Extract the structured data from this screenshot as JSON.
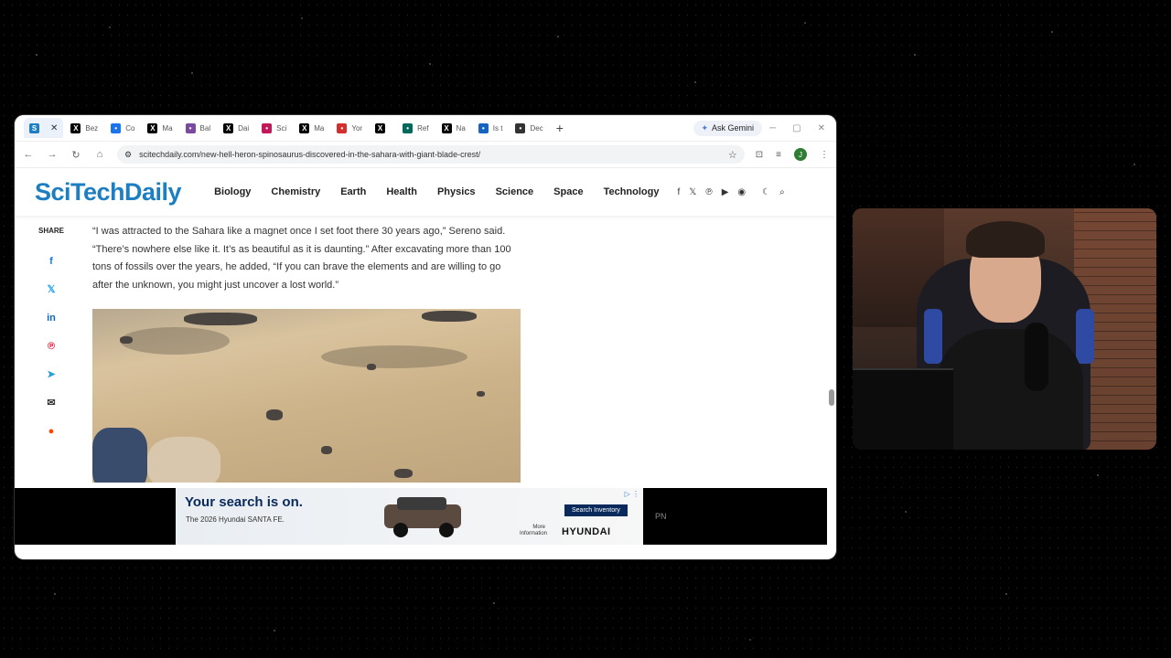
{
  "browser": {
    "tabs": [
      {
        "label": "",
        "icon": "scitechdaily-icon",
        "color": "#1d7fc1",
        "active": true
      },
      {
        "label": "Bez",
        "icon": "x-icon",
        "color": "#000000"
      },
      {
        "label": "Co",
        "icon": "generic-icon",
        "color": "#1a73e8"
      },
      {
        "label": "Ma",
        "icon": "x-icon",
        "color": "#000000"
      },
      {
        "label": "Bal",
        "icon": "generic-icon",
        "color": "#7a4aa0"
      },
      {
        "label": "Dai",
        "icon": "x-icon",
        "color": "#000000"
      },
      {
        "label": "Sci",
        "icon": "generic-icon",
        "color": "#c2185b"
      },
      {
        "label": "Ma",
        "icon": "x-icon",
        "color": "#000000"
      },
      {
        "label": "Yor",
        "icon": "generic-icon",
        "color": "#d32f2f"
      },
      {
        "label": "",
        "icon": "x-icon",
        "color": "#000000"
      },
      {
        "label": "Ref",
        "icon": "generic-icon",
        "color": "#00695c"
      },
      {
        "label": "Na",
        "icon": "x-icon",
        "color": "#000000"
      },
      {
        "label": "Is t",
        "icon": "generic-icon",
        "color": "#1565c0"
      },
      {
        "label": "Dec",
        "icon": "generic-icon",
        "color": "#333333"
      }
    ],
    "gemini_label": "Ask Gemini",
    "url": "scitechdaily.com/new-hell-heron-spinosaurus-discovered-in-the-sahara-with-giant-blade-crest/",
    "avatar_letter": "J"
  },
  "site": {
    "logo": "SciTechDaily",
    "nav": [
      "Biology",
      "Chemistry",
      "Earth",
      "Health",
      "Physics",
      "Science",
      "Space",
      "Technology"
    ]
  },
  "share": {
    "label": "SHARE"
  },
  "article": {
    "paragraph": "“I was attracted to the Sahara like a magnet once I set foot there 30 years ago,” Sereno said. “There’s nowhere else like it. It’s as beautiful as it is daunting.” After excavating more than 100 tons of fossils over the years, he added, “If you can brave the elements and are willing to go after the unknown, you might just uncover a lost world.”"
  },
  "ad": {
    "headline": "Your search is on.",
    "sub": "The 2026 Hyundai SANTA FE.",
    "button": "Search Inventory",
    "more": "More Information",
    "brand": "HYUNDAI",
    "pn": "PN"
  },
  "colors": {
    "brand": "#1d7fc1",
    "ad_navy": "#0a2a5c"
  }
}
